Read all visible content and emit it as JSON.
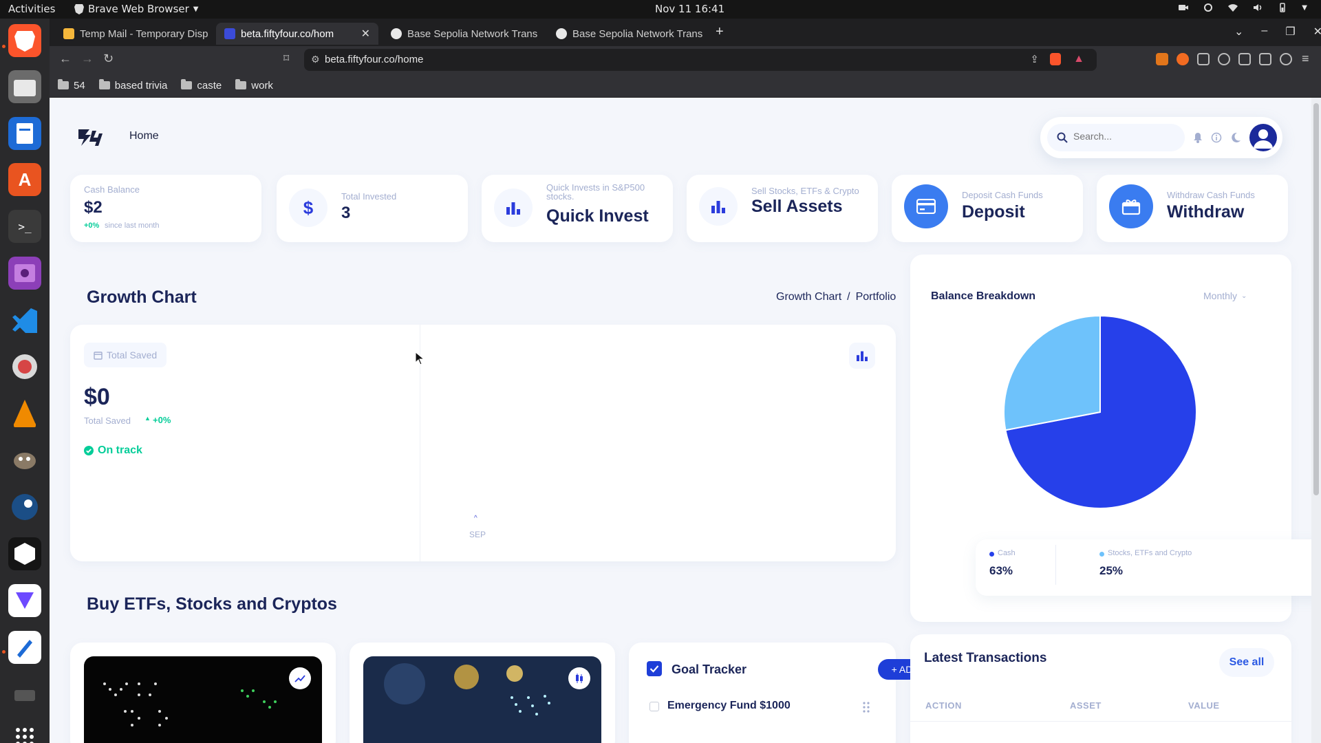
{
  "system": {
    "activities": "Activities",
    "app_name": "Brave Web Browser",
    "clock": "Nov 11  16:41"
  },
  "browser": {
    "tabs": [
      {
        "label": "Temp Mail - Temporary Disp"
      },
      {
        "label": "beta.fiftyfour.co/hom"
      },
      {
        "label": "Base Sepolia Network Trans"
      },
      {
        "label": "Base Sepolia Network Trans"
      }
    ],
    "url": "beta.fiftyfour.co/home",
    "bookmarks": [
      "54",
      "based trivia",
      "caste",
      "work"
    ]
  },
  "header": {
    "home": "Home",
    "search_placeholder": "Search..."
  },
  "stats": {
    "cash_balance": {
      "label": "Cash Balance",
      "value": "$2",
      "change": "+0%",
      "since": "since last month"
    },
    "total_invested": {
      "label": "Total Invested",
      "value": "3"
    },
    "quick_invest": {
      "label": "Quick Invests in S&P500 stocks.",
      "title": "Quick Invest"
    },
    "sell_assets": {
      "label": "Sell Stocks, ETFs & Crypto",
      "title": "Sell Assets"
    },
    "deposit": {
      "label": "Deposit Cash Funds",
      "title": "Deposit"
    },
    "withdraw": {
      "label": "Withdraw Cash Funds",
      "title": "Withdraw"
    }
  },
  "growth": {
    "title": "Growth Chart",
    "crumb_1": "Growth Chart",
    "crumb_sep": "/",
    "crumb_2": "Portfolio",
    "total_saved_btn": "Total Saved",
    "amount": "$0",
    "amount_label": "Total Saved",
    "change": "+0%",
    "status": "On track",
    "x_label": "SEP"
  },
  "balance": {
    "title": "Balance Breakdown",
    "period": "Monthly",
    "cash_label": "Cash",
    "cash_pct": "63%",
    "stocks_label": "Stocks, ETFs and Crypto",
    "stocks_pct": "25%"
  },
  "chart_data": {
    "type": "pie",
    "title": "Balance Breakdown",
    "slices": [
      {
        "label": "Cash",
        "value": 72,
        "color": "#2640ea"
      },
      {
        "label": "Stocks, ETFs and Crypto",
        "value": 28,
        "color": "#6ec2fb"
      }
    ]
  },
  "buy": {
    "title": "Buy ETFs, Stocks and Cryptos"
  },
  "goals": {
    "title": "Goal Tracker",
    "add": "+ ADD",
    "item_1": "Emergency Fund $1000"
  },
  "transactions": {
    "title": "Latest Transactions",
    "see_all": "See all",
    "col_action": "ACTION",
    "col_asset": "ASSET",
    "col_value": "VALUE"
  }
}
